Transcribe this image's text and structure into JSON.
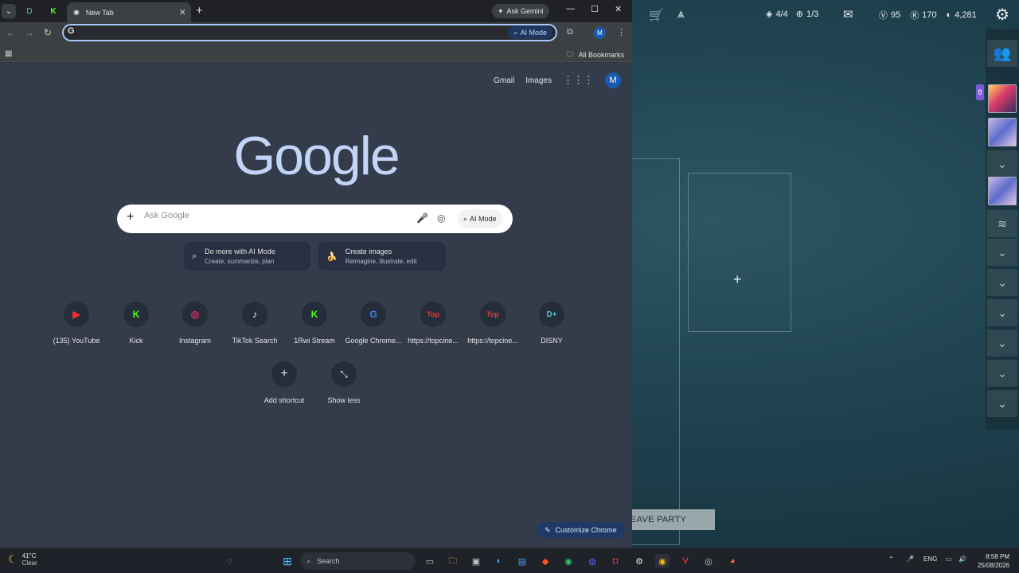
{
  "chrome": {
    "tab_title": "New Tab",
    "ask_gemini": "Ask Gemini",
    "omnibox_ai_mode": "AI Mode",
    "profile_initial": "M",
    "all_bookmarks": "All Bookmarks"
  },
  "ntp": {
    "gmail": "Gmail",
    "images": "Images",
    "profile_initial": "M",
    "logo": "Google",
    "search_placeholder": "Ask Google",
    "ai_mode": "AI Mode",
    "promos": [
      {
        "title": "Do more with AI Mode",
        "subtitle": "Create, summarize, plan"
      },
      {
        "title": "Create images",
        "subtitle": "Reimagine, illustrate, edit"
      }
    ],
    "shortcuts": [
      {
        "label": "(135) YouTube",
        "glyph": "▶"
      },
      {
        "label": "Kick",
        "glyph": "K"
      },
      {
        "label": "Instagram",
        "glyph": "◎"
      },
      {
        "label": "TikTok Search",
        "glyph": "♪"
      },
      {
        "label": "1Rwi Stream",
        "glyph": "K"
      },
      {
        "label": "Google Chrome...",
        "glyph": "G"
      },
      {
        "label": "https://topcine...",
        "glyph": "Top"
      },
      {
        "label": "https://topcine...",
        "glyph": "Top"
      },
      {
        "label": "DISNY",
        "glyph": "D+"
      }
    ],
    "add_shortcut": "Add shortcut",
    "show_less": "Show less",
    "customize": "Customize Chrome"
  },
  "game": {
    "stat1": "4/4",
    "stat2": "1/3",
    "currency1": "95",
    "currency2": "170",
    "currency3": "4,281",
    "leave_party": "EAVE PARTY",
    "side_badge": "8"
  },
  "taskbar": {
    "temp": "41°C",
    "condition": "Clear",
    "search": "Search",
    "lang": "ENG",
    "time": "8:58 PM",
    "date": "25/08/2026"
  },
  "colors": {
    "ntp_bg": "#343b4a",
    "accent": "#a8c7fa"
  }
}
